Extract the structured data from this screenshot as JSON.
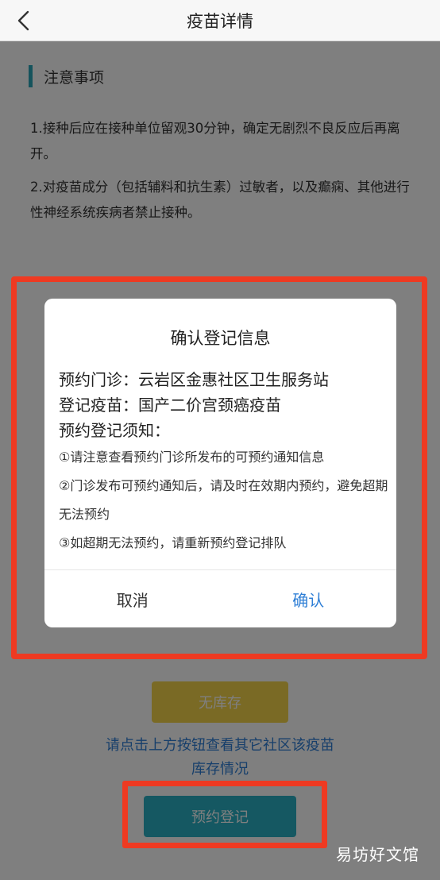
{
  "header": {
    "title": "疫苗详情",
    "back_icon": "chevron-left-icon"
  },
  "section": {
    "title": "注意事项",
    "accent_color": "#2aa6b8"
  },
  "notes": [
    "1.接种后应在接种单位留观30分钟，确定无剧烈不良反应后再离开。",
    "2.对疫苗成分（包括辅料和抗生素）过敏者，以及癫痫、其他进行性神经系统疾病者禁止接种。"
  ],
  "dialog": {
    "title": "确认登记信息",
    "clinic_line": "预约门诊：云岩区金惠社区卫生服务站",
    "vaccine_line": "登记疫苗：国产二价宫颈癌疫苗",
    "notice_heading": "预约登记须知：",
    "notice_items": [
      "①请注意查看预约门诊所发布的可预约通知信息",
      "②门诊发布可预约通知后，请及时在效期内预约，避免超期无法预约",
      "③如超期无法预约，请重新预约登记排队"
    ],
    "cancel_label": "取消",
    "confirm_label": "确认",
    "confirm_color": "#2f7fd6"
  },
  "buttons": {
    "no_stock_label": "无库存",
    "no_stock_color": "#f5d44a",
    "hint": "请点击上方按钮查看其它社区该疫苗库存情况",
    "book_label": "预约登记",
    "book_color": "#2ab1c4"
  },
  "highlight_color": "#ee3a22",
  "watermark": "易坊好文馆"
}
